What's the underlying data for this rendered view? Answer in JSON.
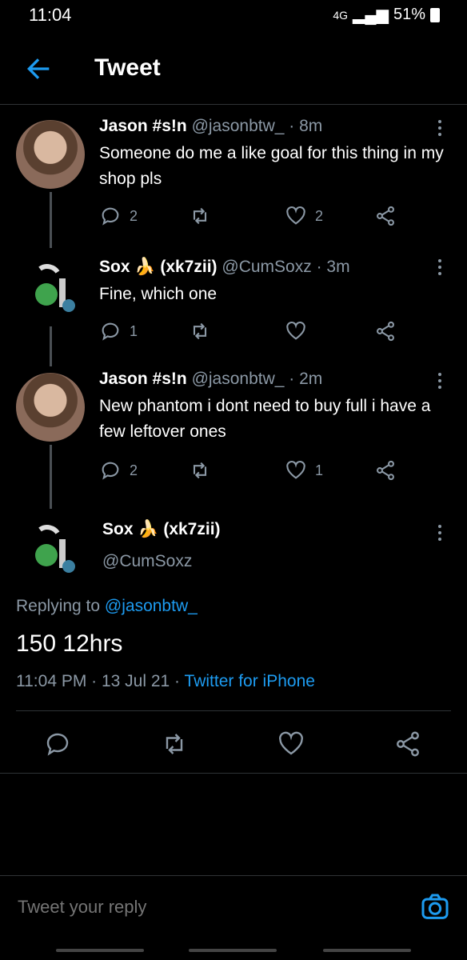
{
  "status": {
    "time": "11:04",
    "network": "4G",
    "battery": "51%"
  },
  "header": {
    "title": "Tweet"
  },
  "tweets": [
    {
      "display_name": "Jason #s!n",
      "handle": "@jasonbtw_",
      "time": "· 8m",
      "text": "Someone do me a like goal for this thing in my shop pls",
      "replies": "2",
      "retweets": "",
      "likes": "2"
    },
    {
      "display_name": "Sox 🍌 (xk7zii)",
      "handle": "@CumSoxz",
      "time": "· 3m",
      "text": "Fine, which one",
      "replies": "1",
      "retweets": "",
      "likes": ""
    },
    {
      "display_name": "Jason #s!n",
      "handle": "@jasonbtw_",
      "time": "· 2m",
      "text": "New phantom i dont need to buy full i have a few leftover ones",
      "replies": "2",
      "retweets": "",
      "likes": "1"
    }
  ],
  "main_tweet": {
    "display_name": "Sox 🍌 (xk7zii)",
    "handle": "@CumSoxz",
    "replying_prefix": "Replying to",
    "replying_to": "@jasonbtw_",
    "text": "150 12hrs",
    "timestamp": "11:04 PM · 13 Jul 21 ·",
    "source": "Twitter for iPhone"
  },
  "reply_box": {
    "placeholder": "Tweet your reply"
  },
  "colors": {
    "accent": "#1d9bf0",
    "background": "#000000",
    "muted": "#8b98a5"
  }
}
